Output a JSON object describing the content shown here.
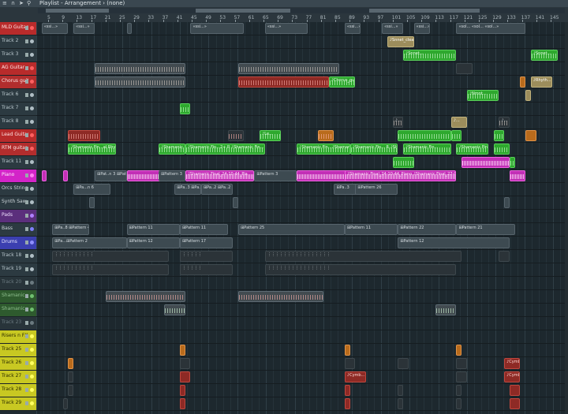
{
  "window": {
    "title": "Playlist - Arrangement › (none)"
  },
  "ruler": {
    "bars": [
      "5",
      "9",
      "13",
      "17",
      "21",
      "25",
      "29",
      "33",
      "37",
      "41",
      "45",
      "49",
      "53",
      "57",
      "61",
      "65",
      "69",
      "73",
      "77",
      "81",
      "85",
      "89",
      "93",
      "97",
      "101",
      "105",
      "109",
      "113",
      "117",
      "121",
      "125",
      "129",
      "133",
      "137",
      "141",
      "145"
    ]
  },
  "tracks": [
    {
      "name": "MLD Guitar",
      "bg": "#b82b2b",
      "fg": "#ffe5e5",
      "dot": "#ff6060"
    },
    {
      "name": "Track 2",
      "bg": "#2c3a41",
      "fg": "#b8c6cc",
      "dot": "#b0bec5"
    },
    {
      "name": "Track 3",
      "bg": "#2c3a41",
      "fg": "#b8c6cc",
      "dot": "#b0bec5"
    },
    {
      "name": "AG Guitar",
      "bg": "#b82b2b",
      "fg": "#ffe5e5",
      "dot": "#ff6060"
    },
    {
      "name": "Chorus guitar",
      "bg": "#b22d2d",
      "fg": "#ffe5e5",
      "dot": "#ff6060"
    },
    {
      "name": "Track 6",
      "bg": "#2c3a41",
      "fg": "#b8c6cc",
      "dot": "#b0bec5"
    },
    {
      "name": "Track 7",
      "bg": "#2c3a41",
      "fg": "#b8c6cc",
      "dot": "#b0bec5"
    },
    {
      "name": "Track 8",
      "bg": "#2c3a41",
      "fg": "#b8c6cc",
      "dot": "#b0bec5"
    },
    {
      "name": "Lead Guitar",
      "bg": "#b82b2b",
      "fg": "#ffe5e5",
      "dot": "#ff6060"
    },
    {
      "name": "RTM guitar",
      "bg": "#b22d2d",
      "fg": "#ffe5e5",
      "dot": "#ff6060"
    },
    {
      "name": "Track 11",
      "bg": "#2c3a41",
      "fg": "#b8c6cc",
      "dot": "#b0bec5"
    },
    {
      "name": "Piano",
      "bg": "#d324c8",
      "fg": "#fff0fd",
      "dot": "#ff80f2"
    },
    {
      "name": "Orcs Strings",
      "bg": "#2c3a41",
      "fg": "#d0d8dc",
      "dot": "#b0bec5"
    },
    {
      "name": "Synth Saw",
      "bg": "#2c3a41",
      "fg": "#d0d8dc",
      "dot": "#b0bec5"
    },
    {
      "name": "Pads",
      "bg": "#5b2f7c",
      "fg": "#efe0ff",
      "dot": "#b080ff"
    },
    {
      "name": "Bass",
      "bg": "#2c3a41",
      "fg": "#d0d8dc",
      "dot": "#8080ff"
    },
    {
      "name": "Drums",
      "bg": "#3b3fb0",
      "fg": "#e8e8ff",
      "dot": "#9090ff"
    },
    {
      "name": "Track 18",
      "bg": "#2c3a41",
      "fg": "#b8c6cc",
      "dot": "#b0bec5"
    },
    {
      "name": "Track 19",
      "bg": "#2c3a41",
      "fg": "#b8c6cc",
      "dot": "#b0bec5"
    },
    {
      "name": "Track 20",
      "bg": "#28343a",
      "fg": "#6b7a80",
      "dot": "#6b7a80"
    },
    {
      "name": "Shamanic vox1 (C)",
      "bg": "#2e5a2e",
      "fg": "#8fbf8f",
      "dot": "#70c070"
    },
    {
      "name": "Shamanic vox1 (C)",
      "bg": "#2e5a2e",
      "fg": "#8fbf8f",
      "dot": "#70c070"
    },
    {
      "name": "Track 23",
      "bg": "#28343a",
      "fg": "#6b7a80",
      "dot": "#6b7a80"
    },
    {
      "name": "Risers n FX",
      "bg": "#c8c822",
      "fg": "#2b2b00",
      "dot": "#ffff60"
    },
    {
      "name": "Track 25",
      "bg": "#c8c822",
      "fg": "#2b2b00",
      "dot": "#ffff60"
    },
    {
      "name": "Track 26",
      "bg": "#c8c822",
      "fg": "#2b2b00",
      "dot": "#ffff60"
    },
    {
      "name": "Track 27",
      "bg": "#c8c822",
      "fg": "#2b2b00",
      "dot": "#ffff60"
    },
    {
      "name": "Track 28",
      "bg": "#c8c822",
      "fg": "#2b2b00",
      "dot": "#ffff60"
    },
    {
      "name": "Track 29",
      "bg": "#c8c822",
      "fg": "#2b2b00",
      "dot": "#ffff60"
    }
  ],
  "clips": [
    {
      "lane": 0,
      "start": 0.01,
      "len": 0.05,
      "type": "gray",
      "label": "«ssi...»"
    },
    {
      "lane": 0,
      "start": 0.07,
      "len": 0.04,
      "type": "gray",
      "label": "«ssi...»"
    },
    {
      "lane": 0,
      "start": 0.17,
      "len": 0.01,
      "type": "gray",
      "label": ""
    },
    {
      "lane": 0,
      "start": 0.29,
      "len": 0.1,
      "type": "gray",
      "label": "«ssi...»"
    },
    {
      "lane": 0,
      "start": 0.43,
      "len": 0.08,
      "type": "gray",
      "label": "«ssi...»"
    },
    {
      "lane": 0,
      "start": 0.58,
      "len": 0.03,
      "type": "gray",
      "label": "«ssi...»"
    },
    {
      "lane": 0,
      "start": 0.65,
      "len": 0.04,
      "type": "gray",
      "label": "«ssi...»"
    },
    {
      "lane": 0,
      "start": 0.71,
      "len": 0.03,
      "type": "gray",
      "label": "«ssi...»"
    },
    {
      "lane": 0,
      "start": 0.79,
      "len": 0.13,
      "type": "gray",
      "label": "«sol... «sol... «sol...»"
    },
    {
      "lane": 1,
      "start": 0.66,
      "len": 0.05,
      "type": "tan",
      "label": "♪Snnet_clean"
    },
    {
      "lane": 2,
      "start": 0.69,
      "len": 0.1,
      "type": "green",
      "label": "♪Snnet...",
      "wave": "green"
    },
    {
      "lane": 2,
      "start": 0.93,
      "len": 0.05,
      "type": "green",
      "label": "♪Snnet...",
      "wave": "green"
    },
    {
      "lane": 3,
      "start": 0.11,
      "len": 0.17,
      "type": "wave",
      "label": "",
      "wave": "gray"
    },
    {
      "lane": 3,
      "start": 0.38,
      "len": 0.19,
      "type": "wave",
      "label": "",
      "wave": "gray"
    },
    {
      "lane": 3,
      "start": 0.79,
      "len": 0.03,
      "type": "dark",
      "label": ""
    },
    {
      "lane": 4,
      "start": 0.11,
      "len": 0.17,
      "type": "wave",
      "label": "",
      "wave": "gray"
    },
    {
      "lane": 4,
      "start": 0.38,
      "len": 0.17,
      "type": "red",
      "label": "",
      "wave": "red"
    },
    {
      "lane": 4,
      "start": 0.55,
      "len": 0.05,
      "type": "green",
      "label": "♪Chorus_gu...",
      "wave": "green"
    },
    {
      "lane": 4,
      "start": 0.91,
      "len": 0.01,
      "type": "orange",
      "label": ""
    },
    {
      "lane": 4,
      "start": 0.93,
      "len": 0.04,
      "type": "tan",
      "label": "♪Rhyth..."
    },
    {
      "lane": 5,
      "start": 0.81,
      "len": 0.06,
      "type": "green",
      "label": "♪Nmnt...",
      "wave": "green"
    },
    {
      "lane": 5,
      "start": 0.92,
      "len": 0.01,
      "type": "tan",
      "label": ""
    },
    {
      "lane": 6,
      "start": 0.27,
      "len": 0.02,
      "type": "green",
      "label": "",
      "wave": "green"
    },
    {
      "lane": 7,
      "start": 0.67,
      "len": 0.02,
      "type": "dark",
      "label": "♪...",
      "wave": "gray"
    },
    {
      "lane": 7,
      "start": 0.78,
      "len": 0.03,
      "type": "tan",
      "label": "♪..."
    },
    {
      "lane": 7,
      "start": 0.87,
      "len": 0.02,
      "type": "dark",
      "label": "♪...",
      "wave": "gray"
    },
    {
      "lane": 8,
      "start": 0.06,
      "len": 0.06,
      "type": "red",
      "label": "",
      "wave": "red"
    },
    {
      "lane": 8,
      "start": 0.36,
      "len": 0.03,
      "type": "dark",
      "label": "",
      "wave": "red"
    },
    {
      "lane": 8,
      "start": 0.42,
      "len": 0.04,
      "type": "green",
      "label": "♪Le...",
      "wave": "green"
    },
    {
      "lane": 8,
      "start": 0.53,
      "len": 0.03,
      "type": "orange",
      "label": "",
      "wave": "red"
    },
    {
      "lane": 8,
      "start": 0.68,
      "len": 0.1,
      "type": "green",
      "label": "",
      "wave": "green"
    },
    {
      "lane": 8,
      "start": 0.78,
      "len": 0.02,
      "type": "green",
      "label": "",
      "wave": "green"
    },
    {
      "lane": 8,
      "start": 0.86,
      "len": 0.02,
      "type": "green",
      "label": "",
      "wave": "green"
    },
    {
      "lane": 8,
      "start": 0.92,
      "len": 0.02,
      "type": "orange",
      "label": ""
    },
    {
      "lane": 9,
      "start": 0.06,
      "len": 0.09,
      "type": "green",
      "label": "♪Shamanic Fin...al Rhyth",
      "wave": "green"
    },
    {
      "lane": 9,
      "start": 0.23,
      "len": 0.05,
      "type": "green",
      "label": "♪Shamanic Fin...",
      "wave": "green"
    },
    {
      "lane": 9,
      "start": 0.28,
      "len": 0.15,
      "type": "green",
      "label": "♪Shamanic Fin...2+ R   ♪Shamanic Fin...",
      "wave": "green"
    },
    {
      "lane": 9,
      "start": 0.49,
      "len": 0.1,
      "type": "green",
      "label": "♪Shamanic Fin...♪Shamanic Fin...",
      "wave": "green"
    },
    {
      "lane": 9,
      "start": 0.59,
      "len": 0.09,
      "type": "green",
      "label": "♪Shamanic Fin... R   ♪Shamanic Fin...",
      "wave": "green"
    },
    {
      "lane": 9,
      "start": 0.69,
      "len": 0.09,
      "type": "green",
      "label": "♪Shamanic Fin...",
      "wave": "green"
    },
    {
      "lane": 9,
      "start": 0.79,
      "len": 0.06,
      "type": "green",
      "label": "♪Shamanic Fin...",
      "wave": "green"
    },
    {
      "lane": 9,
      "start": 0.86,
      "len": 0.03,
      "type": "green",
      "label": "",
      "wave": "green"
    },
    {
      "lane": 10,
      "start": 0.67,
      "len": 0.04,
      "type": "green",
      "label": "",
      "wave": "green"
    },
    {
      "lane": 10,
      "start": 0.8,
      "len": 0.09,
      "type": "magenta",
      "label": "",
      "wave": "mag"
    },
    {
      "lane": 10,
      "start": 0.89,
      "len": 0.01,
      "type": "green",
      "label": "",
      "wave": "green"
    },
    {
      "lane": 11,
      "start": 0.01,
      "len": 0.01,
      "type": "magenta",
      "label": ""
    },
    {
      "lane": 11,
      "start": 0.05,
      "len": 0.01,
      "type": "magenta",
      "label": ""
    },
    {
      "lane": 11,
      "start": 0.11,
      "len": 0.06,
      "type": "gray",
      "label": "⊞Pat..n 3 ⊞Pattern 3"
    },
    {
      "lane": 11,
      "start": 0.17,
      "len": 0.1,
      "type": "magenta",
      "label": "",
      "wave": "mag"
    },
    {
      "lane": 11,
      "start": 0.23,
      "len": 0.05,
      "type": "gray",
      "label": "⊞Pattern 3"
    },
    {
      "lane": 11,
      "start": 0.28,
      "len": 0.13,
      "type": "magenta",
      "label": "♪Shamanic Final_24-10-44_Pia",
      "wave": "mag"
    },
    {
      "lane": 11,
      "start": 0.41,
      "len": 0.08,
      "type": "gray",
      "label": "⊞Pattern 3"
    },
    {
      "lane": 11,
      "start": 0.49,
      "len": 0.15,
      "type": "magenta",
      "label": "",
      "wave": "mag"
    },
    {
      "lane": 11,
      "start": 0.58,
      "len": 0.21,
      "type": "magenta",
      "label": "♪Shamanic Final_24-10-44_Piano ♪Shamanic Final_27-09-32_Piano",
      "wave": "mag"
    },
    {
      "lane": 11,
      "start": 0.89,
      "len": 0.03,
      "type": "magenta",
      "label": "",
      "wave": "mag"
    },
    {
      "lane": 12,
      "start": 0.07,
      "len": 0.07,
      "type": "gray",
      "label": "⊞Pa...n 6"
    },
    {
      "lane": 12,
      "start": 0.26,
      "len": 0.05,
      "type": "gray",
      "label": "⊞Pa..3 ⊞Pa..2"
    },
    {
      "lane": 12,
      "start": 0.31,
      "len": 0.06,
      "type": "gray",
      "label": "⊞Pa..2 ⊞Pa..2"
    },
    {
      "lane": 12,
      "start": 0.56,
      "len": 0.05,
      "type": "gray",
      "label": "⊞Pa..3"
    },
    {
      "lane": 12,
      "start": 0.6,
      "len": 0.08,
      "type": "gray",
      "label": "⊞Pattern 26"
    },
    {
      "lane": 13,
      "start": 0.1,
      "len": 0.01,
      "type": "gray",
      "label": ""
    },
    {
      "lane": 13,
      "start": 0.37,
      "len": 0.01,
      "type": "gray",
      "label": ""
    },
    {
      "lane": 13,
      "start": 0.88,
      "len": 0.01,
      "type": "gray",
      "label": ""
    },
    {
      "lane": 15,
      "start": 0.03,
      "len": 0.07,
      "type": "gray",
      "label": "⊞Pa..8 ⊞Pattern 4"
    },
    {
      "lane": 15,
      "start": 0.17,
      "len": 0.1,
      "type": "gray",
      "label": "⊞Pattern 11"
    },
    {
      "lane": 15,
      "start": 0.27,
      "len": 0.09,
      "type": "gray",
      "label": "⊞Pattern 11"
    },
    {
      "lane": 15,
      "start": 0.38,
      "len": 0.2,
      "type": "gray",
      "label": "⊞Pattern 25"
    },
    {
      "lane": 15,
      "start": 0.58,
      "len": 0.1,
      "type": "gray",
      "label": "⊞Pattern 11"
    },
    {
      "lane": 15,
      "start": 0.68,
      "len": 0.11,
      "type": "gray",
      "label": "⊞Pattern 22"
    },
    {
      "lane": 15,
      "start": 0.79,
      "len": 0.11,
      "type": "gray",
      "label": "⊞Pattern 21"
    },
    {
      "lane": 16,
      "start": 0.03,
      "len": 0.14,
      "type": "gray",
      "label": "⊞Pa...⊞Pattern 2"
    },
    {
      "lane": 16,
      "start": 0.17,
      "len": 0.1,
      "type": "gray",
      "label": "⊞Pattern 12"
    },
    {
      "lane": 16,
      "start": 0.27,
      "len": 0.1,
      "type": "gray",
      "label": "⊞Pattern 17"
    },
    {
      "lane": 16,
      "start": 0.68,
      "len": 0.21,
      "type": "gray",
      "label": "⊞Pattern 12"
    },
    {
      "lane": 17,
      "start": 0.03,
      "len": 0.22,
      "type": "dark",
      "label": "⋮⋮⋮⋮⋮⋮⋮⋮⋮⋮"
    },
    {
      "lane": 17,
      "start": 0.27,
      "len": 0.1,
      "type": "dark",
      "label": "⋮⋮⋮⋮⋮"
    },
    {
      "lane": 17,
      "start": 0.43,
      "len": 0.37,
      "type": "dark",
      "label": "⋮⋮⋮⋮⋮⋮⋮⋮⋮⋮⋮⋮⋮⋮⋮⋮"
    },
    {
      "lane": 17,
      "start": 0.87,
      "len": 0.02,
      "type": "dark",
      "label": ""
    },
    {
      "lane": 18,
      "start": 0.03,
      "len": 0.22,
      "type": "dark",
      "label": "⋮⋮⋮⋮⋮⋮⋮⋮⋮⋮"
    },
    {
      "lane": 18,
      "start": 0.27,
      "len": 0.1,
      "type": "dark",
      "label": "⋮⋮⋮⋮⋮"
    },
    {
      "lane": 18,
      "start": 0.43,
      "len": 0.36,
      "type": "dark",
      "label": "⋮⋮⋮⋮⋮⋮⋮⋮⋮⋮⋮⋮⋮⋮⋮⋮"
    },
    {
      "lane": 20,
      "start": 0.13,
      "len": 0.15,
      "type": "wave",
      "label": "",
      "wave": "red"
    },
    {
      "lane": 20,
      "start": 0.38,
      "len": 0.16,
      "type": "wave",
      "label": "",
      "wave": "red"
    },
    {
      "lane": 21,
      "start": 0.24,
      "len": 0.04,
      "type": "wave",
      "label": "",
      "wave": "green"
    },
    {
      "lane": 21,
      "start": 0.75,
      "len": 0.04,
      "type": "wave",
      "label": "",
      "wave": "green"
    },
    {
      "lane": 24,
      "start": 0.27,
      "len": 0.01,
      "type": "orange",
      "label": ""
    },
    {
      "lane": 24,
      "start": 0.58,
      "len": 0.01,
      "type": "orange",
      "label": ""
    },
    {
      "lane": 24,
      "start": 0.79,
      "len": 0.01,
      "type": "orange",
      "label": ""
    },
    {
      "lane": 25,
      "start": 0.06,
      "len": 0.01,
      "type": "orange",
      "label": ""
    },
    {
      "lane": 25,
      "start": 0.27,
      "len": 0.02,
      "type": "dark",
      "label": ""
    },
    {
      "lane": 25,
      "start": 0.58,
      "len": 0.02,
      "type": "dark",
      "label": ""
    },
    {
      "lane": 25,
      "start": 0.68,
      "len": 0.02,
      "type": "dark",
      "label": ""
    },
    {
      "lane": 25,
      "start": 0.79,
      "len": 0.02,
      "type": "dark",
      "label": ""
    },
    {
      "lane": 25,
      "start": 0.88,
      "len": 0.03,
      "type": "red",
      "label": "♪Cymb..."
    },
    {
      "lane": 26,
      "start": 0.06,
      "len": 0.01,
      "type": "dark",
      "label": ""
    },
    {
      "lane": 26,
      "start": 0.27,
      "len": 0.02,
      "type": "red",
      "label": ""
    },
    {
      "lane": 26,
      "start": 0.58,
      "len": 0.04,
      "type": "red",
      "label": "♪Cymb..."
    },
    {
      "lane": 26,
      "start": 0.79,
      "len": 0.02,
      "type": "dark",
      "label": ""
    },
    {
      "lane": 26,
      "start": 0.88,
      "len": 0.03,
      "type": "red",
      "label": "♪Cymb..."
    },
    {
      "lane": 27,
      "start": 0.06,
      "len": 0.01,
      "type": "dark",
      "label": ""
    },
    {
      "lane": 27,
      "start": 0.27,
      "len": 0.01,
      "type": "red",
      "label": ""
    },
    {
      "lane": 27,
      "start": 0.58,
      "len": 0.01,
      "type": "red",
      "label": ""
    },
    {
      "lane": 27,
      "start": 0.68,
      "len": 0.01,
      "type": "dark",
      "label": ""
    },
    {
      "lane": 27,
      "start": 0.79,
      "len": 0.01,
      "type": "dark",
      "label": ""
    },
    {
      "lane": 27,
      "start": 0.89,
      "len": 0.02,
      "type": "red",
      "label": ""
    },
    {
      "lane": 28,
      "start": 0.05,
      "len": 0.01,
      "type": "dark",
      "label": ""
    },
    {
      "lane": 28,
      "start": 0.27,
      "len": 0.01,
      "type": "red",
      "label": ""
    },
    {
      "lane": 28,
      "start": 0.58,
      "len": 0.01,
      "type": "red",
      "label": ""
    },
    {
      "lane": 28,
      "start": 0.68,
      "len": 0.01,
      "type": "dark",
      "label": ""
    },
    {
      "lane": 28,
      "start": 0.79,
      "len": 0.01,
      "type": "dark",
      "label": ""
    },
    {
      "lane": 28,
      "start": 0.89,
      "len": 0.02,
      "type": "red",
      "label": ""
    }
  ]
}
